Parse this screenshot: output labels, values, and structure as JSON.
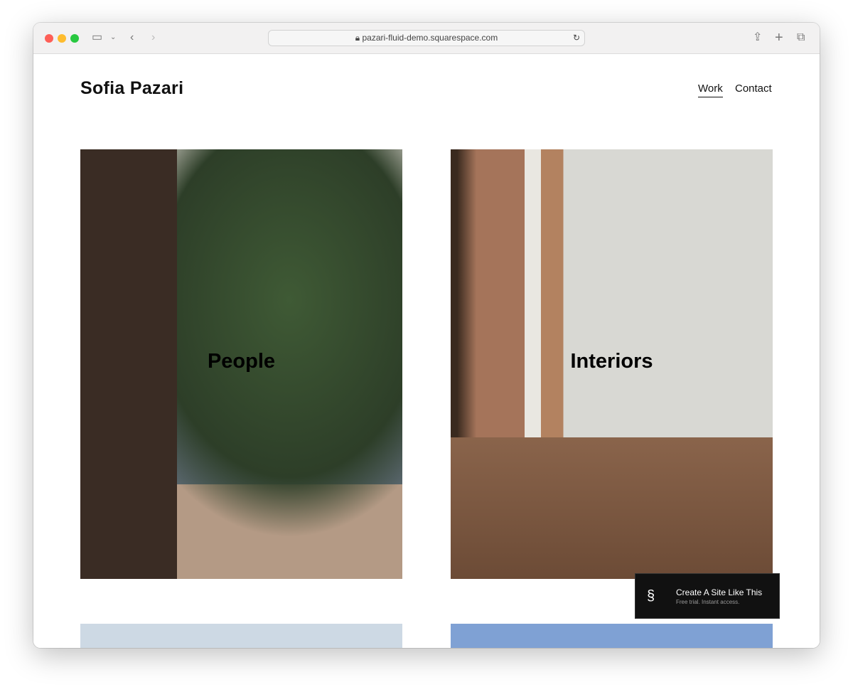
{
  "browser": {
    "url": "pazari-fluid-demo.squarespace.com",
    "traffic_colors": [
      "#fe5f57",
      "#febc2e",
      "#28c840"
    ]
  },
  "site": {
    "title": "Sofia Pazari",
    "nav": [
      {
        "label": "Work",
        "active": true
      },
      {
        "label": "Contact",
        "active": false
      }
    ]
  },
  "gallery": [
    {
      "label": "People"
    },
    {
      "label": "Interiors"
    }
  ],
  "badge": {
    "title": "Create A Site Like This",
    "subtitle": "Free trial. Instant access."
  }
}
